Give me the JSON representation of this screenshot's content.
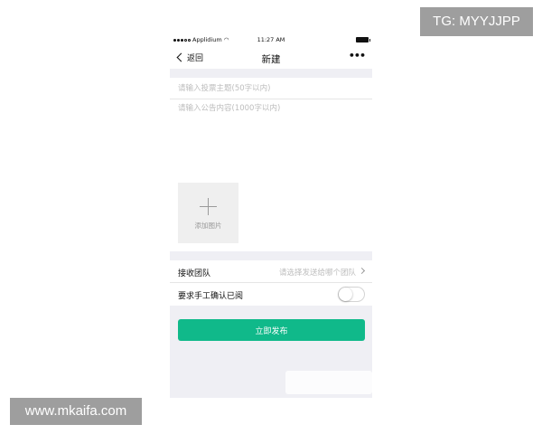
{
  "status_bar": {
    "carrier": "Applidium",
    "time": "11:27 AM",
    "wifi_icon": "wifi-icon",
    "battery_icon": "battery-icon"
  },
  "nav": {
    "back_label": "返回",
    "title": "新建",
    "more_label": "•••"
  },
  "form": {
    "title_placeholder": "请输入投票主题(50字以内)",
    "content_placeholder": "请输入公告内容(1000字以内)",
    "add_image_label": "添加图片"
  },
  "settings": {
    "team_label": "接收团队",
    "team_placeholder": "请选择发送给哪个团队",
    "confirm_label": "要求手工确认已阅",
    "confirm_enabled": false
  },
  "actions": {
    "publish_label": "立即发布"
  },
  "colors": {
    "accent": "#10b98a",
    "background": "#efeff4"
  },
  "watermarks": {
    "telegram": "TG: MYYJJPP",
    "site": "www.mkaifa.com"
  }
}
